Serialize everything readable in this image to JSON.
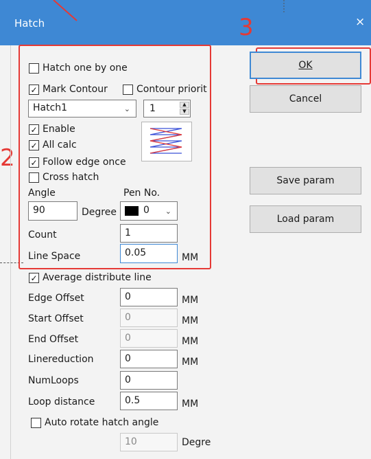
{
  "dialog": {
    "title": "Hatch",
    "close_glyph": "×"
  },
  "annotations": {
    "box2_number": "2",
    "box3_number": "3",
    "color": "#e53935"
  },
  "checkboxes": {
    "hatch_one_by_one": {
      "label": "Hatch one by one",
      "checked": false
    },
    "mark_contour": {
      "label": "Mark Contour",
      "checked": true
    },
    "contour_priority": {
      "label": "Contour priorit",
      "checked": false
    },
    "enable": {
      "label": "Enable",
      "checked": true
    },
    "all_calc": {
      "label": "All calc",
      "checked": true
    },
    "follow_edge_once": {
      "label": "Follow edge once",
      "checked": true
    },
    "cross_hatch": {
      "label": "Cross hatch",
      "checked": false
    },
    "average_distribute_line": {
      "label": "Average distribute line",
      "checked": true
    },
    "auto_rotate_hatch_angle": {
      "label": "Auto rotate hatch angle",
      "checked": false
    }
  },
  "hatch_select": {
    "value": "Hatch1"
  },
  "hatch_spin": {
    "value": "1"
  },
  "hatch_pattern_icon": "zigzag-hatch-icon",
  "angle": {
    "label": "Angle",
    "value": "90",
    "unit": "Degree"
  },
  "pen": {
    "label": "Pen No.",
    "value": "0",
    "swatch_color": "#000000"
  },
  "count": {
    "label": "Count",
    "value": "1"
  },
  "line_space": {
    "label": "Line Space",
    "value": "0.05",
    "unit": "MM"
  },
  "edge_offset": {
    "label": "Edge Offset",
    "value": "0",
    "unit": "MM"
  },
  "start_offset": {
    "label": "Start Offset",
    "value": "0",
    "unit": "MM"
  },
  "end_offset": {
    "label": "End Offset",
    "value": "0",
    "unit": "MM"
  },
  "linereduction": {
    "label": "Linereduction",
    "value": "0",
    "unit": "MM"
  },
  "num_loops": {
    "label": "NumLoops",
    "value": "0"
  },
  "loop_distance": {
    "label": "Loop distance",
    "value": "0.5",
    "unit": "MM"
  },
  "auto_rotate_value": {
    "value": "10",
    "unit": "Degre"
  },
  "buttons": {
    "ok": "OK",
    "cancel": "Cancel",
    "save_param": "Save param",
    "load_param": "Load param"
  }
}
